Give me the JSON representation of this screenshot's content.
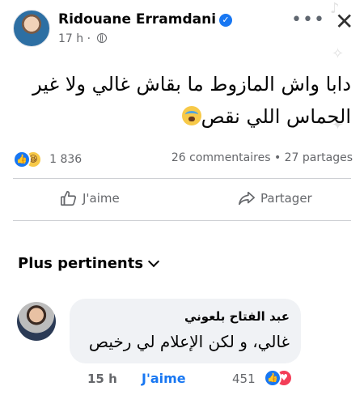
{
  "post": {
    "author": "Ridouane Erramdani",
    "time": "17 h",
    "text_line1": "دابا واش المازوط ما بقاش غالي ولا غير",
    "text_line2": "الحماس اللي نقص"
  },
  "stats": {
    "reactions_count": "1 836",
    "comments_shares": "26 commentaires • 27 partages"
  },
  "actions": {
    "like_label": "J'aime",
    "share_label": "Partager"
  },
  "comments_section": {
    "sort_label": "Plus pertinents"
  },
  "comment": {
    "author": "عبد الفتاح بلعوني",
    "text": "غالي، و لكن الإعلام لي رخيص",
    "time": "15 h",
    "like_label": "J'aime",
    "reactions_count": "451"
  },
  "colors": {
    "accent": "#1877f2",
    "secondary_text": "#65676b",
    "bubble": "#f0f2f5",
    "love": "#f33e58"
  }
}
